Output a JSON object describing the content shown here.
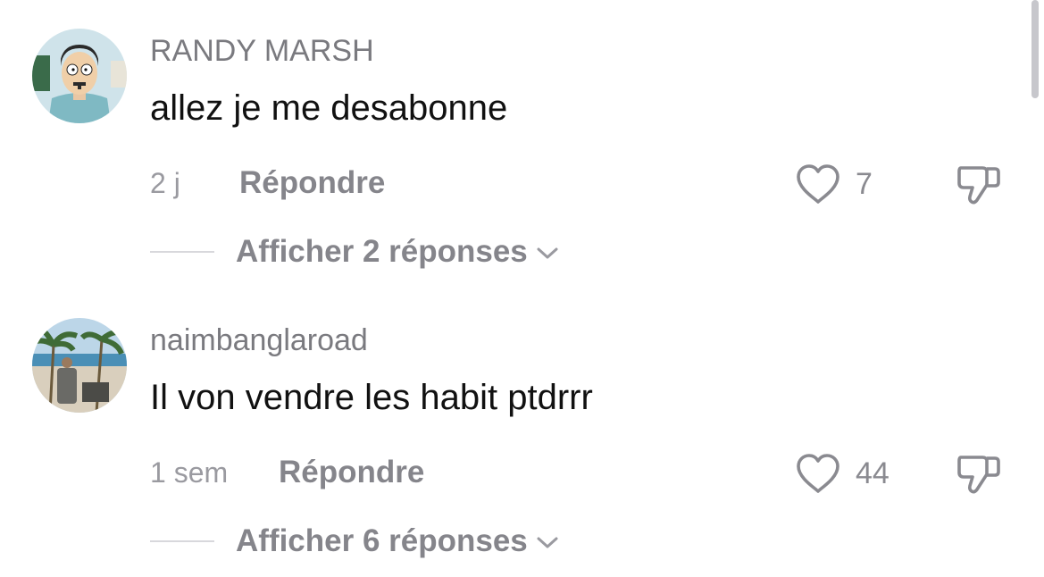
{
  "comments": [
    {
      "username": "RANDY MARSH",
      "text": "allez je me desabonne",
      "time": "2 j",
      "reply_label": "Répondre",
      "likes": "7",
      "view_replies_label": "Afficher 2 réponses",
      "avatar_icon": "cartoon-character-avatar"
    },
    {
      "username": "naimbanglaroad",
      "text": "Il von vendre les habit ptdrrr",
      "time": "1 sem",
      "reply_label": "Répondre",
      "likes": "44",
      "view_replies_label": "Afficher 6 réponses",
      "avatar_icon": "beach-photo-avatar"
    }
  ],
  "icons": {
    "like": "heart-icon",
    "dislike": "thumbs-down-icon",
    "expand": "chevron-down-icon"
  },
  "colors": {
    "username": "#7a7a7f",
    "text": "#111111",
    "secondary": "#85858b",
    "icon": "#8a8a90"
  }
}
